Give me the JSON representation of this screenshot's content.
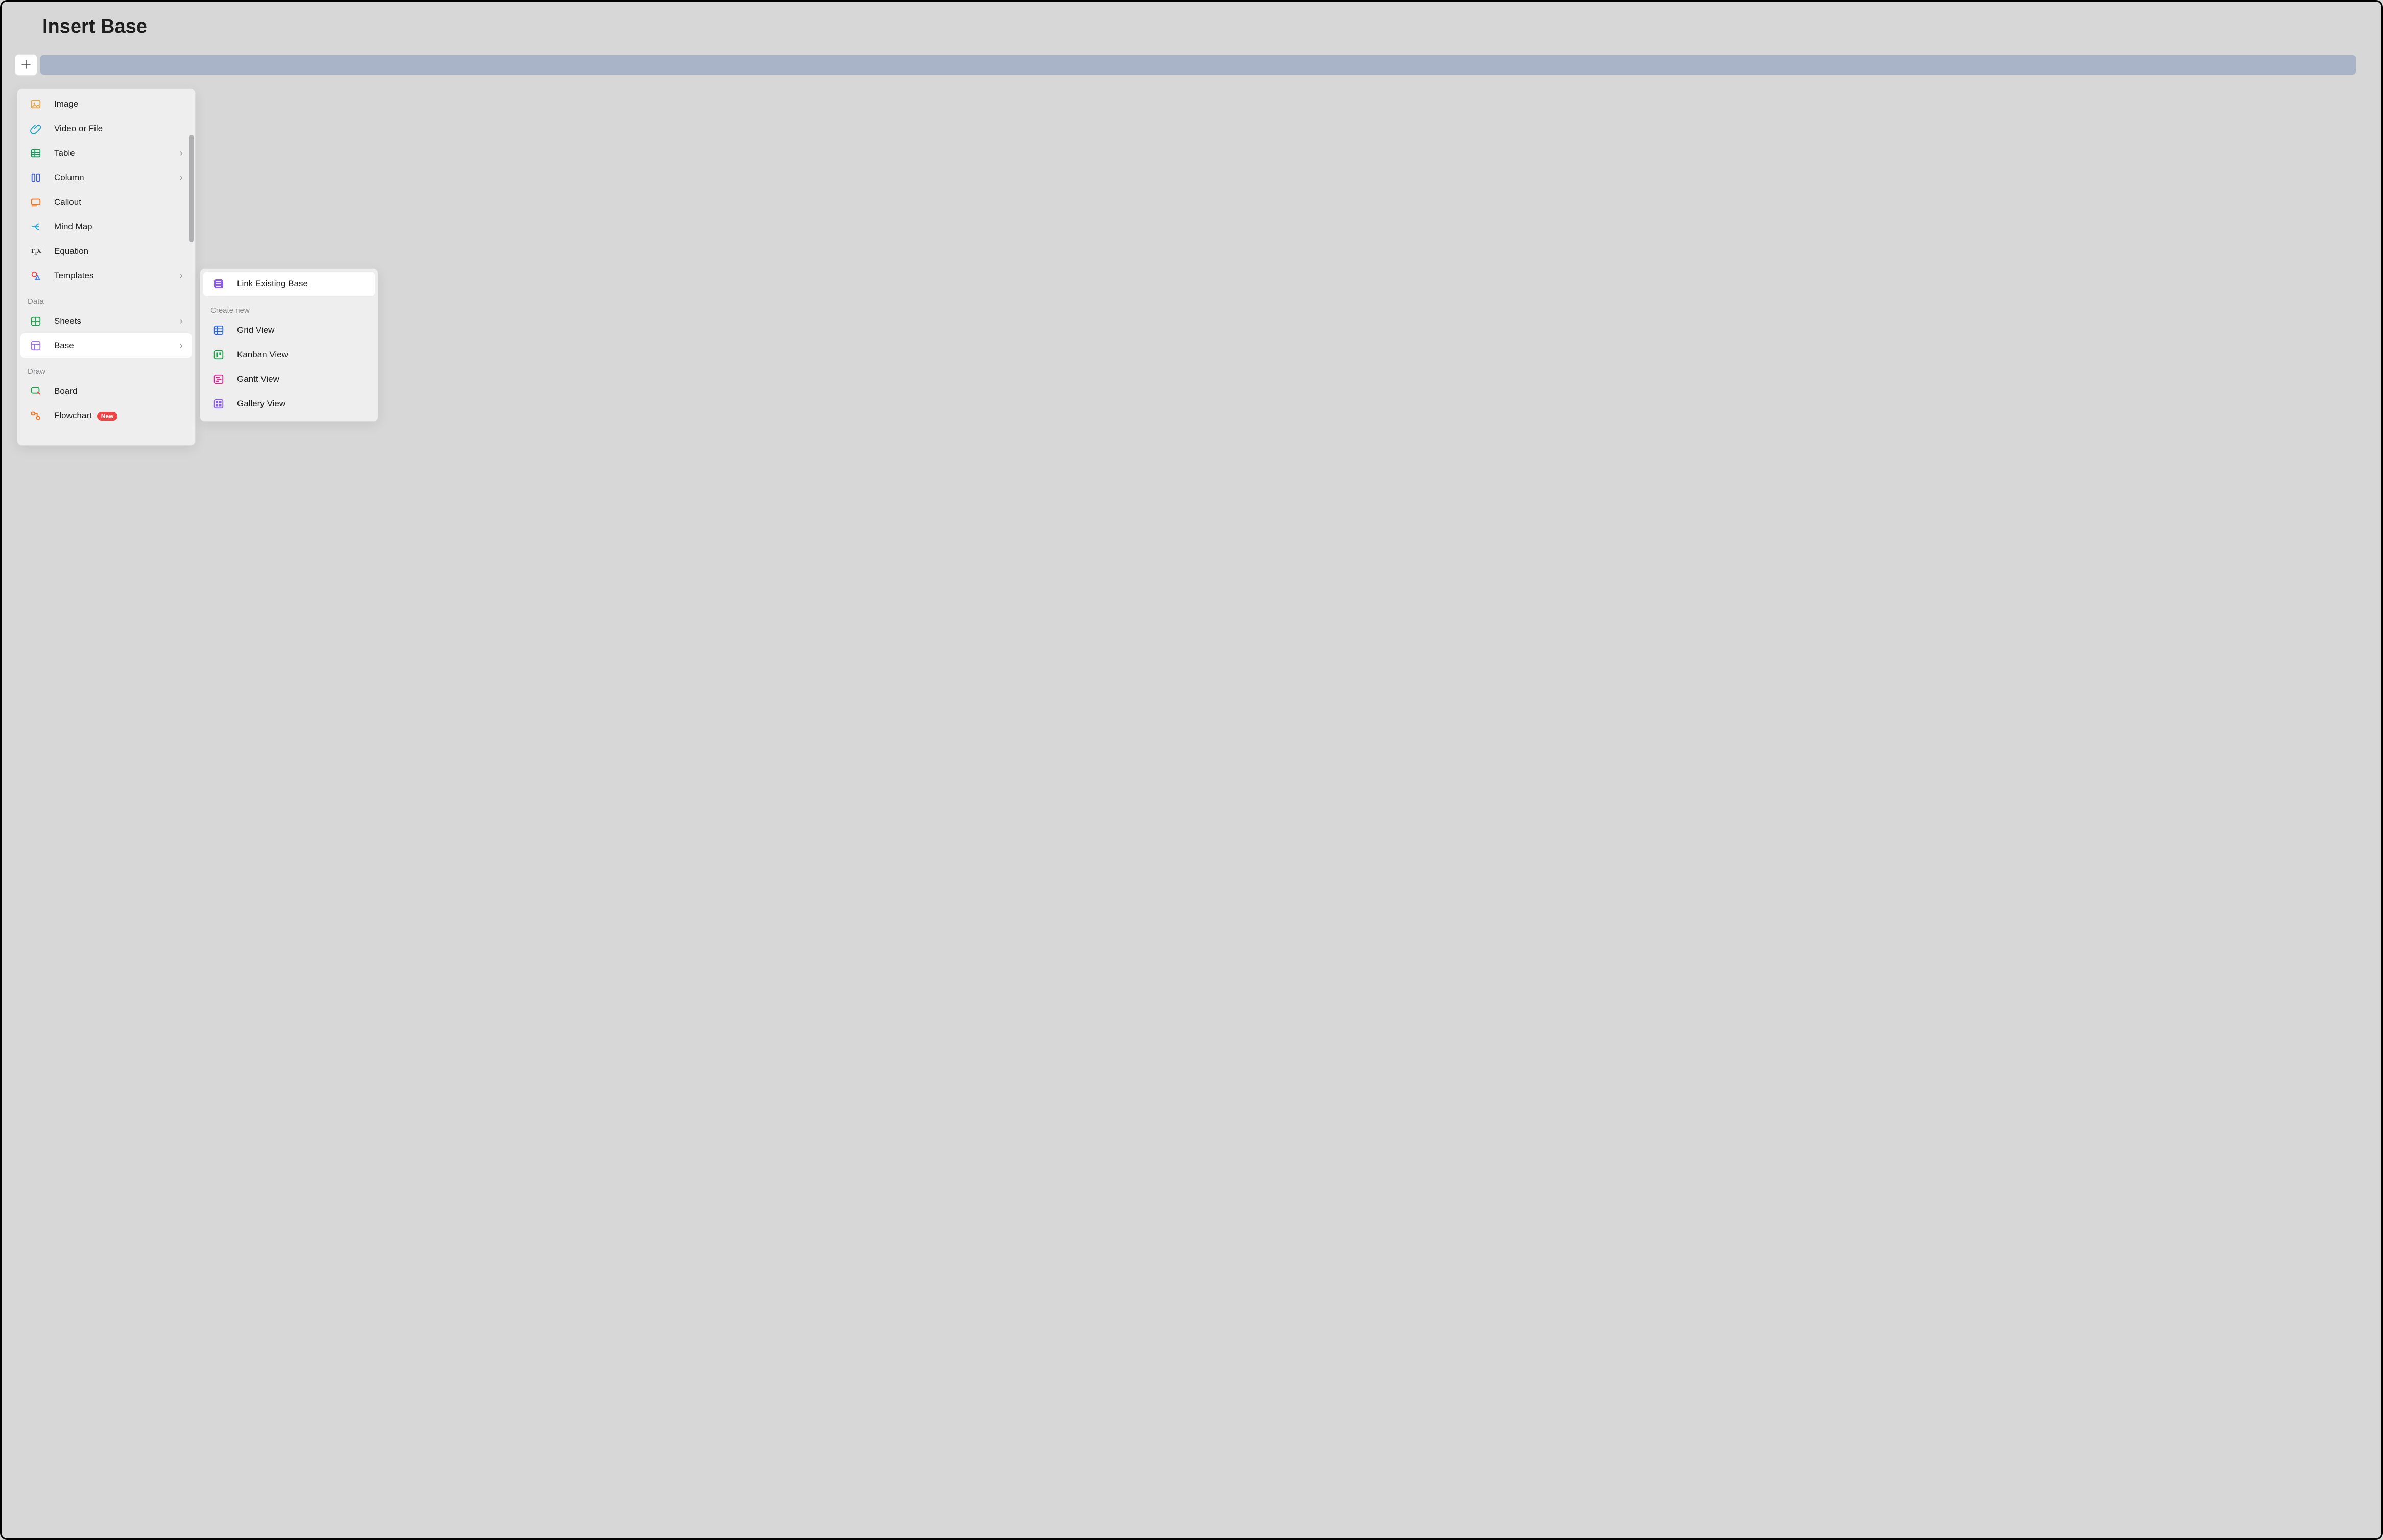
{
  "title": "Insert Base",
  "insert_menu": {
    "items": [
      {
        "icon": "image-icon",
        "label": "Image",
        "has_submenu": false
      },
      {
        "icon": "attach-icon",
        "label": "Video or File",
        "has_submenu": false
      },
      {
        "icon": "table-icon",
        "label": "Table",
        "has_submenu": true
      },
      {
        "icon": "column-icon",
        "label": "Column",
        "has_submenu": true
      },
      {
        "icon": "callout-icon",
        "label": "Callout",
        "has_submenu": false
      },
      {
        "icon": "mindmap-icon",
        "label": "Mind Map",
        "has_submenu": false
      },
      {
        "icon": "equation-icon",
        "label": "Equation",
        "has_submenu": false
      },
      {
        "icon": "templates-icon",
        "label": "Templates",
        "has_submenu": true
      }
    ],
    "section_data": "Data",
    "data_items": [
      {
        "icon": "sheets-icon",
        "label": "Sheets",
        "has_submenu": true,
        "selected": false
      },
      {
        "icon": "base-icon",
        "label": "Base",
        "has_submenu": true,
        "selected": true
      }
    ],
    "section_draw": "Draw",
    "draw_items": [
      {
        "icon": "board-icon",
        "label": "Board",
        "badge": null
      },
      {
        "icon": "flowchart-icon",
        "label": "Flowchart",
        "badge": "New"
      }
    ]
  },
  "submenu": {
    "primary": {
      "icon": "base-link-icon",
      "label": "Link Existing Base"
    },
    "section": "Create new",
    "views": [
      {
        "icon": "grid-view-icon",
        "label": "Grid View"
      },
      {
        "icon": "kanban-view-icon",
        "label": "Kanban View"
      },
      {
        "icon": "gantt-view-icon",
        "label": "Gantt View"
      },
      {
        "icon": "gallery-view-icon",
        "label": "Gallery View"
      }
    ]
  }
}
